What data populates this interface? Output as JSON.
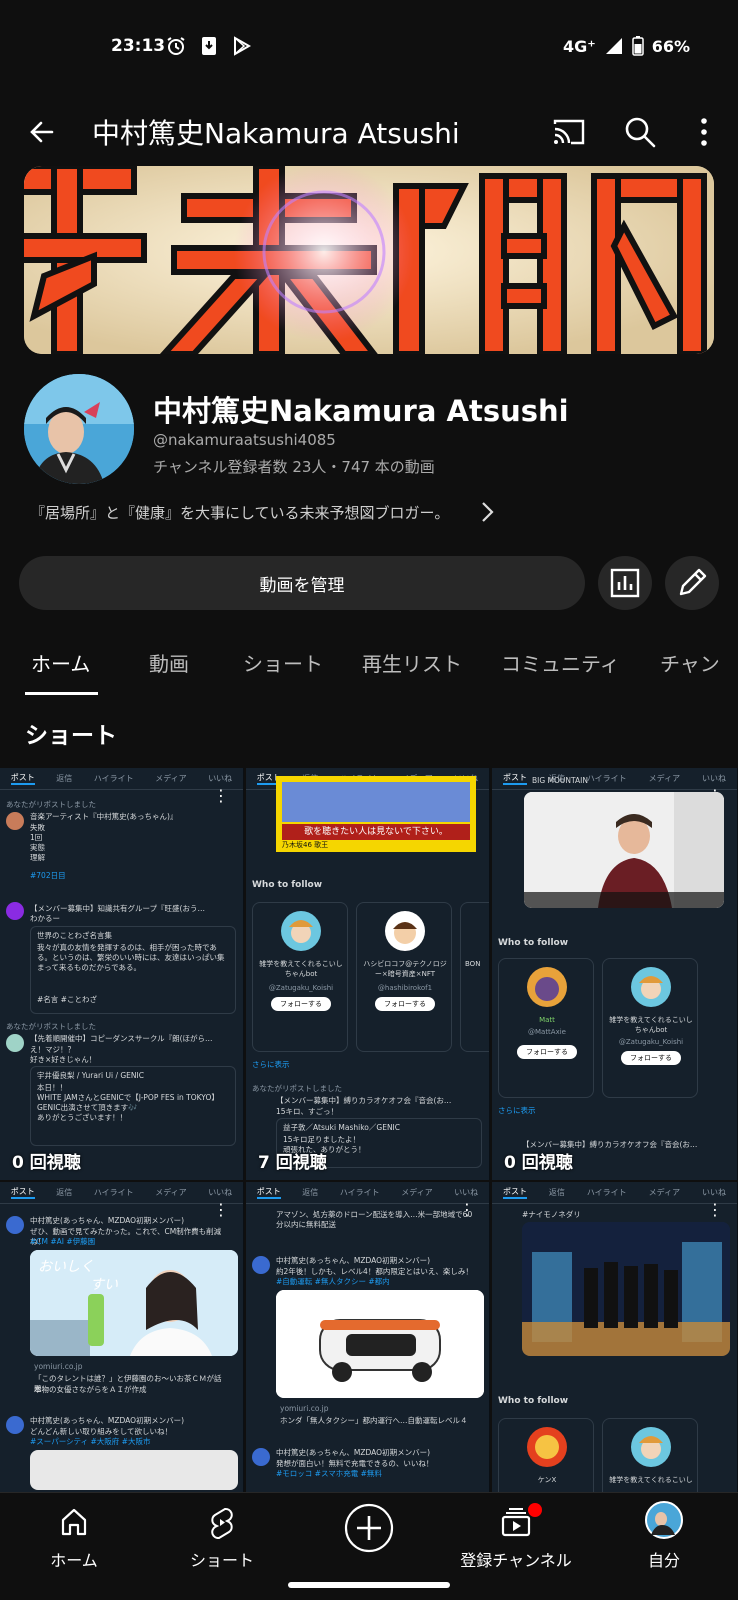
{
  "status": {
    "time": "23:13",
    "network": "4G⁺",
    "battery": "66%"
  },
  "app_bar": {
    "title": "中村篤史Nakamura Atsushi",
    "icons": [
      "back-arrow-icon",
      "cast-icon",
      "search-icon",
      "more-vert-icon"
    ]
  },
  "channel": {
    "banner_text": "未来予想図",
    "name": "中村篤史Nakamura Atsushi",
    "handle": "@nakamuraatsushi4085",
    "stats": "チャンネル登録者数 23人・747 本の動画",
    "description": "『居場所』と『健康』を大事にしている未来予想図ブロガー。"
  },
  "actions": {
    "manage_label": "動画を管理"
  },
  "tabs": [
    {
      "label": "ホーム"
    },
    {
      "label": "動画"
    },
    {
      "label": "ショート"
    },
    {
      "label": "再生リスト"
    },
    {
      "label": "コミュニティ"
    },
    {
      "label": "チャン"
    }
  ],
  "section": {
    "title": "ショート"
  },
  "shorts": [
    {
      "views": "0 回視聴",
      "tw_tabs": [
        "ポスト",
        "返信",
        "ハイライト",
        "メディア",
        "いいね"
      ],
      "lines": [
        "あなたがリポストしました",
        "音楽アーティスト『中村篤史(あっちゃん)』",
        "失敗",
        "1回",
        "実態",
        "理解",
        "#702日目",
        "【メンバー募集中】知識共有グループ『旺盛(おう…",
        "わかるー",
        "世界のことわざ名言集",
        "我々が真の友情を発揮するのは、相手が困った時である。というのは、繁栄のいい時には、友達はいっぱい集まって来るものだからである。",
        "#名言 #ことわざ",
        "あなたがリポストしました",
        "【先着順開催中】コピーダンスサークル『朗(ほがら…",
        "え！マジ！？",
        "好き×好きじゃん！",
        "宇井優良梨 / Yurari Ui / GENIC",
        "本日！！",
        "WHITE JAMさんとGENICで【J-POP FES in TOKYO】",
        "GENIC出演させて頂きます🎶",
        "ありがとうございます！！"
      ]
    },
    {
      "views": "7 回視聴",
      "tw_tabs": [
        "ポスト",
        "返信",
        "ハイライト",
        "メディア",
        "いいね"
      ],
      "lines": [
        "歌を聴きたい人は見ないで下さい。",
        "乃木坂46 歌王",
        "Who to follow",
        "雑学を教えてくれるこいしちゃんbot",
        "@Zatugaku_Koishi",
        "フォローする",
        "ハシビロコフ@テクノロジー×暗号資産×NFT",
        "@hashibirokof1",
        "フォローする",
        "BON",
        "さらに表示",
        "あなたがリポストしました",
        "【メンバー募集中】縛りカラオケオフ会『音会(お…",
        "15キロ、すごっ！",
        "益子敦／Atsuki Mashiko／GENIC",
        "15キロ足りましたよ！",
        "頑張れた、ありがとう！"
      ]
    },
    {
      "views": "0 回視聴",
      "tw_tabs": [
        "ポスト",
        "返信",
        "ハイライト",
        "メディア",
        "いいね"
      ],
      "lines": [
        "BIG MOUNTAIN",
        "Who to follow",
        "Matt",
        "@MattAxie",
        "フォローする",
        "雑学を教えてくれるこいしちゃんbot",
        "@Zatugaku_Koishi",
        "フォローする",
        "さらに表示",
        "【メンバー募集中】縛りカラオケオフ会『音会(お…"
      ]
    },
    {
      "views": "",
      "tw_tabs": [
        "ポスト",
        "返信",
        "ハイライト",
        "メディア",
        "いいね"
      ],
      "lines": [
        "中村篤史(あっちゃん、MZDAO初期メンバー)",
        "ぜひ、動画で見てみたかった。これで、CM制作費も削減ね！",
        "#CM #AI #伊藤園",
        "おいしく",
        "すい",
        "yomiuri.co.jp",
        "「このタレントは誰？」と伊藤園のお～いお茶ＣＭが話題…",
        "本物の女優さながらをＡＩが作成",
        "中村篤史(あっちゃん、MZDAO初期メンバー)",
        "どんどん新しい取り組みをして欲しいね！",
        "#スーパーシティ #大阪府 #大阪市"
      ]
    },
    {
      "views": "",
      "tw_tabs": [
        "ポスト",
        "返信",
        "ハイライト",
        "メディア",
        "いいね"
      ],
      "lines": [
        "アマゾン、処方薬のドローン配送を導入…米一部地域で60分以内に無料配送",
        "中村篤史(あっちゃん、MZDAO初期メンバー)",
        "約2年後！しかも、レベル4！都内限定とはいえ、楽しみ！",
        "#自動運転 #無人タクシー #都内",
        "yomiuri.co.jp",
        "ホンダ「無人タクシー」都内運行へ…自動運転レベル４",
        "中村篤史(あっちゃん、MZDAO初期メンバー)",
        "発想が面白い！無料で充電できるの、いいね！",
        "#モロッコ #スマホ充電 #無料"
      ]
    },
    {
      "views": "",
      "tw_tabs": [
        "ポスト",
        "返信",
        "ハイライト",
        "メディア",
        "いいね"
      ],
      "lines": [
        "#ナイモノネダリ",
        "Who to follow",
        "ケンX",
        "雑学を教えてくれるこいし"
      ]
    }
  ],
  "bottom_nav": [
    {
      "label": "ホーム",
      "icon": "home-icon"
    },
    {
      "label": "ショート",
      "icon": "shorts-icon"
    },
    {
      "label": "",
      "icon": "create-plus-icon"
    },
    {
      "label": "登録チャンネル",
      "icon": "subscriptions-icon"
    },
    {
      "label": "自分",
      "icon": "avatar"
    }
  ],
  "colors": {
    "background": "#0f0f0f",
    "chip": "#272727",
    "banner_red": "#f04a1f",
    "twitter_bg": "#15202b",
    "twitter_blue": "#1d9bf0",
    "notification_red": "#ff0000"
  }
}
